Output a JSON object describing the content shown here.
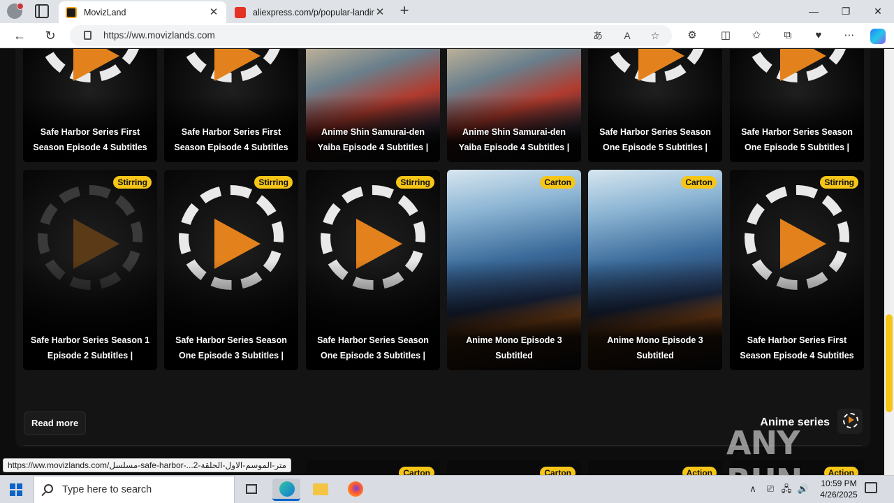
{
  "browser": {
    "tabs": [
      {
        "title": "MovizLand",
        "active": true
      },
      {
        "title": "aliexpress.com/p/popular-landin",
        "active": false
      }
    ],
    "url": "https://ww.movizlands.com",
    "window_controls": {
      "minimize": "—",
      "restore": "❐",
      "close": "✕"
    },
    "nav": {
      "back": "←",
      "reload": "↻"
    },
    "url_icons": {
      "translate": "あ",
      "read_aloud": "A",
      "favorite": "☆"
    },
    "toolbar_icons": {
      "extensions": "⚙",
      "split": "◫",
      "favorites": "✩",
      "collections": "⧉",
      "performance": "♥",
      "more": "⋯"
    }
  },
  "grid": {
    "row1": [
      {
        "title": "Safe Harbor Series First Season Episode 4 Subtitles",
        "art": "play"
      },
      {
        "title": "Safe Harbor Series First Season Episode 4 Subtitles",
        "art": "play"
      },
      {
        "title": "Anime Shin Samurai-den Yaiba Episode 4 Subtitles |",
        "art": "yaiba"
      },
      {
        "title": "Anime Shin Samurai-den Yaiba Episode 4 Subtitles |",
        "art": "yaiba"
      },
      {
        "title": "Safe Harbor Series Season One Episode 5 Subtitles |",
        "art": "play"
      },
      {
        "title": "Safe Harbor Series Season One Episode 5 Subtitles |",
        "art": "play"
      }
    ],
    "row2": [
      {
        "title": "Safe Harbor Series Season 1 Episode 2 Subtitles |",
        "badge": "Stirring",
        "art": "play-dim"
      },
      {
        "title": "Safe Harbor Series Season One Episode 3 Subtitles |",
        "badge": "Stirring",
        "art": "play"
      },
      {
        "title": "Safe Harbor Series Season One Episode 3 Subtitles |",
        "badge": "Stirring",
        "art": "play"
      },
      {
        "title": "Anime Mono Episode 3 Subtitled",
        "badge": "Carton",
        "art": "mono"
      },
      {
        "title": "Anime Mono Episode 3 Subtitled",
        "badge": "Carton",
        "art": "mono"
      },
      {
        "title": "Safe Harbor Series First Season Episode 4 Subtitles",
        "badge": "Stirring",
        "art": "play"
      }
    ],
    "row3_badges": [
      "Carton",
      "Carton",
      "Action",
      "Action"
    ]
  },
  "section": {
    "read_more": "Read more",
    "title": "Anime series"
  },
  "status_bar_url": "https://ww.movizlands.com/مسلسل-safe-harbor-...متر-الموسم-الاول-الحلقة-2",
  "watermark": "ANY RUN",
  "taskbar": {
    "search_placeholder": "Type here to search",
    "time": "10:59 PM",
    "date": "4/26/2025",
    "tray": {
      "chevron": "∧",
      "network": "🖧",
      "volume": "🔊"
    }
  }
}
